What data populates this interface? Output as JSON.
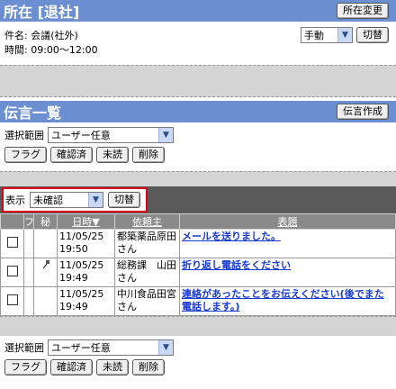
{
  "status": {
    "title": "所在 [退社]",
    "change_button": "所在変更",
    "subject_label": "件名:",
    "subject_value": "会議(社外)",
    "time_label": "時間:",
    "time_value": "09:00～12:00",
    "mode_select": "手動",
    "switch_button": "切替"
  },
  "messages": {
    "title": "伝言一覧",
    "create_button": "伝言作成",
    "range_label": "選択範囲",
    "range_select": "ユーザー任意",
    "flag_button": "フラグ",
    "confirmed_button": "確認済",
    "unread_button": "未読",
    "delete_button": "削除"
  },
  "filter": {
    "label": "表示",
    "select": "未確認",
    "switch_button": "切替"
  },
  "table": {
    "headers": [
      "フ",
      "秘",
      "日時▼",
      "依頼主",
      "表題"
    ],
    "rows": [
      {
        "date": "11/05/25",
        "time": "19:50",
        "requester": "都築薬品原田さん",
        "subject": "メールを送りました。",
        "secret_icon": false
      },
      {
        "date": "11/05/25",
        "time": "19:49",
        "requester": "総務課　山田さん",
        "subject": "折り返し電話をください",
        "secret_icon": true
      },
      {
        "date": "11/05/25",
        "time": "19:49",
        "requester": "中川食品田宮さん",
        "subject": "連絡があったことをお伝えください(後でまた 電話します。)",
        "secret_icon": false
      }
    ]
  },
  "bottom": {
    "range_label": "選択範囲",
    "range_select": "ユーザー任意",
    "flag_button": "フラグ",
    "confirmed_button": "確認済",
    "unread_button": "未読",
    "delete_button": "削除"
  }
}
